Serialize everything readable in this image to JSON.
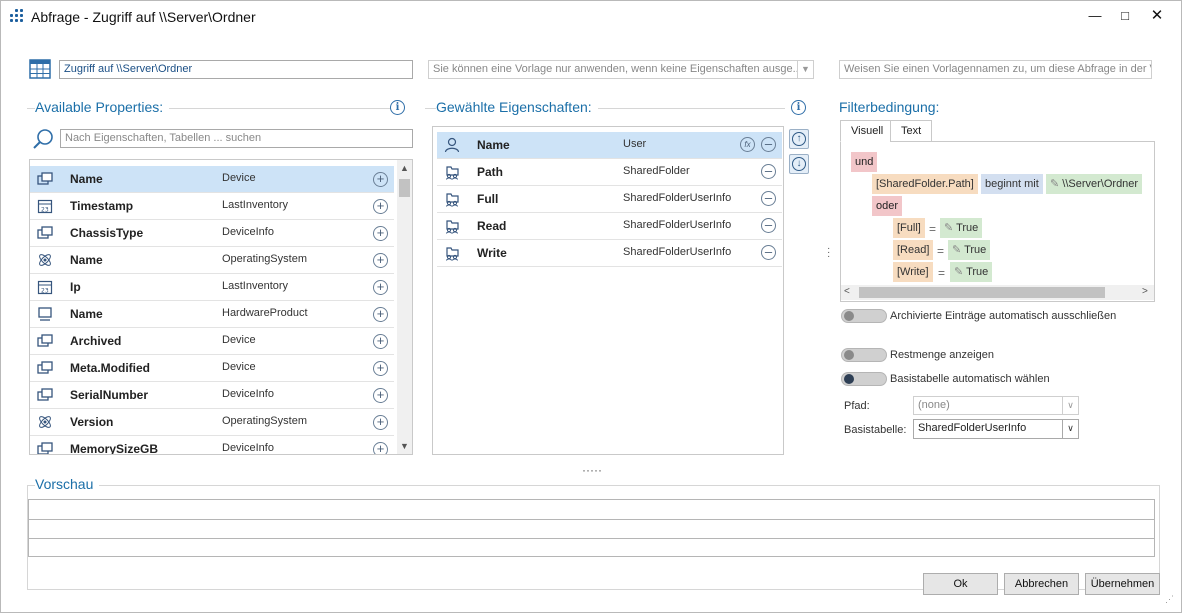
{
  "window": {
    "title": "Abfrage - Zugriff auf \\\\Server\\Ordner"
  },
  "header": {
    "query_name": "Zugriff auf \\\\Server\\Ordner",
    "template_hint": "Sie können eine Vorlage nur anwenden, wenn keine Eigenschaften ausge...",
    "template_name_placeholder": "Weisen Sie einen Vorlagennamen zu, um diese Abfrage in der Vo"
  },
  "available": {
    "title": "Available Properties:",
    "search_placeholder": "Nach Eigenschaften, Tabellen ... suchen",
    "items": [
      {
        "name": "Name",
        "table": "Device",
        "icon": "device-icon"
      },
      {
        "name": "Timestamp",
        "table": "LastInventory",
        "icon": "calendar-icon"
      },
      {
        "name": "ChassisType",
        "table": "DeviceInfo",
        "icon": "device-icon"
      },
      {
        "name": "Name",
        "table": "OperatingSystem",
        "icon": "atom-icon"
      },
      {
        "name": "Ip",
        "table": "LastInventory",
        "icon": "calendar-icon"
      },
      {
        "name": "Name",
        "table": "HardwareProduct",
        "icon": "monitor-icon"
      },
      {
        "name": "Archived",
        "table": "Device",
        "icon": "device-icon"
      },
      {
        "name": "Meta.Modified",
        "table": "Device",
        "icon": "device-icon"
      },
      {
        "name": "SerialNumber",
        "table": "DeviceInfo",
        "icon": "device-icon"
      },
      {
        "name": "Version",
        "table": "OperatingSystem",
        "icon": "atom-icon"
      },
      {
        "name": "MemorySizeGB",
        "table": "DeviceInfo",
        "icon": "device-icon"
      }
    ]
  },
  "selected": {
    "title": "Gewählte Eigenschaften:",
    "items": [
      {
        "name": "Name",
        "table": "User",
        "icon": "user-icon"
      },
      {
        "name": "Path",
        "table": "SharedFolder",
        "icon": "shared-folder-icon"
      },
      {
        "name": "Full",
        "table": "SharedFolderUserInfo",
        "icon": "shared-folder-icon"
      },
      {
        "name": "Read",
        "table": "SharedFolderUserInfo",
        "icon": "shared-folder-icon"
      },
      {
        "name": "Write",
        "table": "SharedFolderUserInfo",
        "icon": "shared-folder-icon"
      }
    ]
  },
  "filter": {
    "title": "Filterbedingung:",
    "tabs": [
      "Visuell",
      "Text"
    ],
    "and_label": "und",
    "field": "[SharedFolder.Path]",
    "operator": "beginnt mit",
    "value": "\\\\Server\\Ordner",
    "or_label": "oder",
    "conditions": [
      {
        "field": "[Full]",
        "eq": "=",
        "value": "True"
      },
      {
        "field": "[Read]",
        "eq": "=",
        "value": "True"
      },
      {
        "field": "[Write]",
        "eq": "=",
        "value": "True"
      }
    ]
  },
  "options": {
    "archived_label": "Archivierte Einträge automatisch ausschließen",
    "rest_label": "Restmenge anzeigen",
    "base_label": "Basistabelle automatisch wählen",
    "path_label": "Pfad:",
    "path_value": "(none)",
    "basetable_label": "Basistabelle:",
    "basetable_value": "SharedFolderUserInfo"
  },
  "preview": {
    "title": "Vorschau"
  },
  "buttons": {
    "ok": "Ok",
    "cancel": "Abbrechen",
    "apply": "Übernehmen"
  }
}
